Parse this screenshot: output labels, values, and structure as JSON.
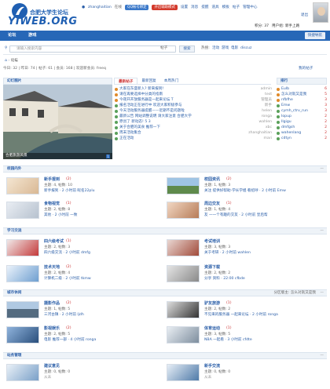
{
  "header": {
    "logo_cn": "合肥大学生论坛",
    "logo_en": "YIWEB.ORG",
    "user": "zhanghaitian",
    "online": "在线",
    "pill1": "QQ帐号绑定",
    "pill2": "开启辅助模式",
    "links": [
      "设置",
      "消息",
      "提醒",
      "道具",
      "模板",
      "帖子",
      "管理中心",
      "退出"
    ],
    "line2": [
      "积分: 37",
      "用户组: 新手上路"
    ],
    "colors": {
      "pill1": "#3a78c9",
      "pill2": "#d33a2c"
    }
  },
  "nav": {
    "items": [
      "论坛",
      "游戏"
    ],
    "quick": "快捷导航"
  },
  "search": {
    "placeholder": "请输入搜索内容",
    "scope": "帖子",
    "button": "搜索",
    "hot_label": "热搜:",
    "hot": [
      "活动",
      "游戏",
      "电影",
      "discuz"
    ]
  },
  "breadcrumb": {
    "home": "⌂",
    "current": "论坛"
  },
  "stats": {
    "text": "今日: 32 | 昨日: 74 | 帖子: 61 | 会员: 168 | 欢迎新会员: freeq",
    "latest": "我的帖子"
  },
  "sections": {
    "slides": "幻灯图片",
    "rank": "排行"
  },
  "slide_caption": "合肥旅游风景",
  "tabs": [
    "最新帖子",
    "最新回复",
    "本周热门"
  ],
  "threads": [
    {
      "title": "大家在东盛新入? 新来报到!",
      "user": "admin"
    },
    {
      "title": "请在再要选择中分类的指南",
      "user": "test"
    },
    {
      "title": "今夜开开放服务器是一起来论坛 T",
      "user": "管理员"
    },
    {
      "title": "报名活动正在进行中 欢迎大家积极参与",
      "user": "新手"
    },
    {
      "title": "今天活动服务器提醒——近期不是问题啦",
      "user": "helen"
    },
    {
      "title": "最新公告 网站调整说明 请大家注意 合肥大学",
      "user": "ronga"
    },
    {
      "title": "原创了 新动态! 5 3",
      "user": "wahlen"
    },
    {
      "title": "关于合肥的美食 推荐一下",
      "user": "xbc"
    },
    {
      "title": "周末活动集合",
      "user": "zhanghaitian"
    },
    {
      "title": "正在活动",
      "user": "mari"
    }
  ],
  "rank": [
    {
      "name": "Eulb",
      "num": "6"
    },
    {
      "name": "怎么对就又是我",
      "num": "5"
    },
    {
      "name": "nfbfhe",
      "num": "3"
    },
    {
      "name": "Emw",
      "num": "3"
    },
    {
      "name": "cymh_ctrv_run",
      "num": "3"
    },
    {
      "name": "Iopup",
      "num": "2"
    },
    {
      "name": "Ilgigu",
      "num": "2"
    },
    {
      "name": "dmfgsh",
      "num": "2"
    },
    {
      "name": "wahenlang",
      "num": "2"
    },
    {
      "name": "cdtyn",
      "num": "2"
    }
  ],
  "cats": [
    {
      "title": "校园内外",
      "mod": "",
      "forums": [
        {
          "name": "新手报到",
          "today": "(2)",
          "count": "主题: 4, 帖数: 10",
          "last": "新手报到 · 2 小时前 昵名22plu"
        },
        {
          "name": "校园资讯",
          "today": "(2)",
          "count": "主题: 1, 帖数: 3",
          "last": "关注 提供好帮助·学长学姐·看招呼 · 2 小时前 Emw"
        },
        {
          "name": "食物视觉",
          "today": "(1)",
          "count": "主题: 2, 帖数: 8",
          "last": "其他 · 2 小时前 一致"
        },
        {
          "name": "周边交友",
          "today": "(1)",
          "count": "主题: 1, 帖数: 4",
          "last": "友 一一个有趣的交友 · 2 小时前 皇后帮"
        }
      ]
    },
    {
      "title": "学习交流",
      "mod": "",
      "forums": [
        {
          "name": "四六级考试",
          "today": "(1)",
          "count": "主题: 2, 帖数: 3",
          "last": "四六级交流 · 2 小时前 dmfg"
        },
        {
          "name": "考试培训",
          "today": "",
          "count": "主题: 3, 帖数: 3",
          "last": "关于考研 · 2 小时前 wahlen"
        },
        {
          "name": "技术天地",
          "today": "(2)",
          "count": "主题: 2, 帖数: 4",
          "last": "计算机二级 · 2 小时前 tkmw"
        },
        {
          "name": "资源下载",
          "today": "",
          "count": "主题: 2, 帖数: 2",
          "last": "分享 资料 · 22:00 cfbde"
        }
      ]
    },
    {
      "title": "城市休闲",
      "mod": "分区版主: 怎么对就又是我",
      "forums": [
        {
          "name": "摄影作品",
          "today": "(2)",
          "count": "主题: 1, 帖数: 5",
          "last": "三河古镇 · 2 小时前 ljdh"
        },
        {
          "name": "驴友旅游",
          "today": "(1)",
          "count": "主题: 2, 帖数: 2",
          "last": "不见来的服务器 一起来论坛 · 2 小时前 ronga"
        },
        {
          "name": "影视娱乐",
          "today": "(2)",
          "count": "主题: 2, 帖数: 5",
          "last": "电影 推荐一部 · 4 小时前 ronga"
        },
        {
          "name": "体育运动",
          "today": "(1)",
          "count": "主题: 3, 帖数: 5",
          "last": "NBA 一起看 · 3 小时前 cfdte"
        }
      ]
    },
    {
      "title": "站务管理",
      "mod": "",
      "forums": [
        {
          "name": "建议意见",
          "today": "",
          "count": "主题: 0, 帖数: 0",
          "last": "从未"
        },
        {
          "name": "新手交流",
          "today": "",
          "count": "主题: 0, 帖数: 0",
          "last": "从未"
        }
      ]
    }
  ]
}
